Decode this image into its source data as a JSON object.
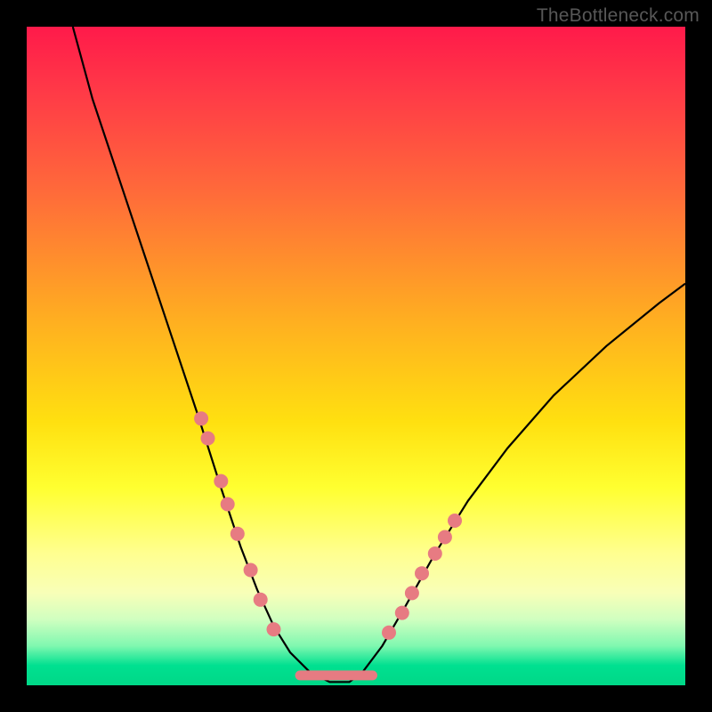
{
  "watermark": "TheBottleneck.com",
  "chart_data": {
    "type": "line",
    "title": "",
    "xlabel": "",
    "ylabel": "",
    "xlim": [
      0,
      100
    ],
    "ylim": [
      0,
      100
    ],
    "series": [
      {
        "name": "curve",
        "x": [
          7,
          10,
          14,
          18,
          22,
          26,
          29.5,
          32.5,
          35,
          37.5,
          40,
          43,
          46,
          49,
          51,
          54,
          57.5,
          62,
          67,
          73,
          80,
          88,
          96,
          100
        ],
        "y": [
          100,
          89,
          77,
          65,
          53,
          41,
          30,
          21,
          14.5,
          9,
          5,
          2,
          0.5,
          0.5,
          2,
          6,
          12,
          20,
          28,
          36,
          44,
          51.5,
          58,
          61
        ]
      }
    ],
    "markers": {
      "name": "dots",
      "color": "#e77b82",
      "radius": 8,
      "points_xy": [
        [
          26.5,
          40.5
        ],
        [
          27.5,
          37.5
        ],
        [
          29.5,
          31
        ],
        [
          30.5,
          27.5
        ],
        [
          32,
          23
        ],
        [
          34,
          17.5
        ],
        [
          35.5,
          13
        ],
        [
          37.5,
          8.5
        ],
        [
          55,
          8
        ],
        [
          57,
          11
        ],
        [
          58.5,
          14
        ],
        [
          60,
          17
        ],
        [
          62,
          20
        ],
        [
          63.5,
          22.5
        ],
        [
          65,
          25
        ]
      ]
    },
    "flat_segment": {
      "color": "#e77b82",
      "width": 11,
      "x_from": 41.5,
      "x_to": 52.5,
      "y": 1.5
    }
  }
}
